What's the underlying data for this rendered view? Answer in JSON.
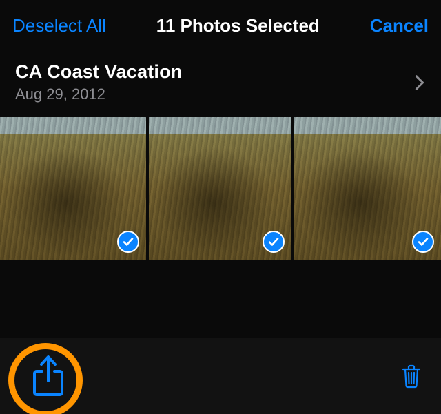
{
  "header": {
    "deselect_label": "Deselect All",
    "title": "11 Photos Selected",
    "cancel_label": "Cancel"
  },
  "album": {
    "title": "CA Coast Vacation",
    "date": "Aug 29, 2012"
  },
  "photos": [
    {
      "selected": true
    },
    {
      "selected": true
    },
    {
      "selected": true
    }
  ],
  "icons": {
    "share": "share-icon",
    "trash": "trash-icon",
    "chevron": "chevron-right-icon",
    "check": "checkmark-icon"
  },
  "colors": {
    "accent": "#0a84ff",
    "highlight_ring": "#ff9500",
    "text_primary": "#ffffff",
    "text_secondary": "#8e8e93",
    "background": "#0a0a0a",
    "toolbar": "#121212"
  }
}
